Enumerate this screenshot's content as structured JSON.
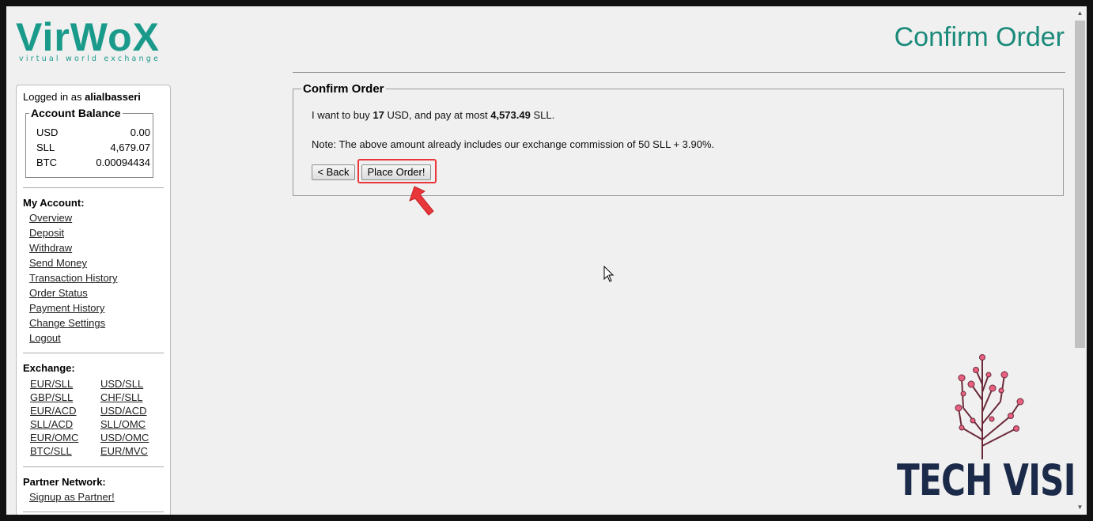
{
  "logo": {
    "main": "VirWoX",
    "tagline": "virtual world exchange"
  },
  "page_title": "Confirm Order",
  "sidebar": {
    "logged_in_prefix": "Logged in as",
    "username": "alialbasseri",
    "balance_title": "Account Balance",
    "balances": [
      {
        "currency": "USD",
        "amount": "0.00"
      },
      {
        "currency": "SLL",
        "amount": "4,679.07"
      },
      {
        "currency": "BTC",
        "amount": "0.00094434"
      }
    ],
    "my_account_heading": "My Account:",
    "account_links": [
      "Overview",
      "Deposit",
      "Withdraw",
      "Send Money",
      "Transaction History",
      "Order Status",
      "Payment History",
      "Change Settings",
      "Logout"
    ],
    "exchange_heading": "Exchange:",
    "exchange_links": [
      [
        "EUR/SLL",
        "USD/SLL"
      ],
      [
        "GBP/SLL",
        "CHF/SLL"
      ],
      [
        "EUR/ACD",
        "USD/ACD"
      ],
      [
        "SLL/ACD",
        "SLL/OMC"
      ],
      [
        "EUR/OMC",
        "USD/OMC"
      ],
      [
        "BTC/SLL",
        "EUR/MVC"
      ]
    ],
    "partner_heading": "Partner Network:",
    "partner_link": "Signup as Partner!"
  },
  "confirm": {
    "legend": "Confirm Order",
    "line1_a": "I want to buy",
    "qty": "17",
    "line1_b": "USD, and pay at most",
    "max_pay": "4,573.49",
    "line1_c": "SLL.",
    "note": "Note: The above amount already includes our exchange commission of 50 SLL + 3.90%.",
    "back_label": "< Back",
    "place_label": "Place Order!"
  },
  "watermark": {
    "text": "TECH VISION"
  },
  "colors": {
    "brand": "#1a9a8a",
    "highlight": "#e8363a",
    "watermark": "#1c2a4a"
  }
}
